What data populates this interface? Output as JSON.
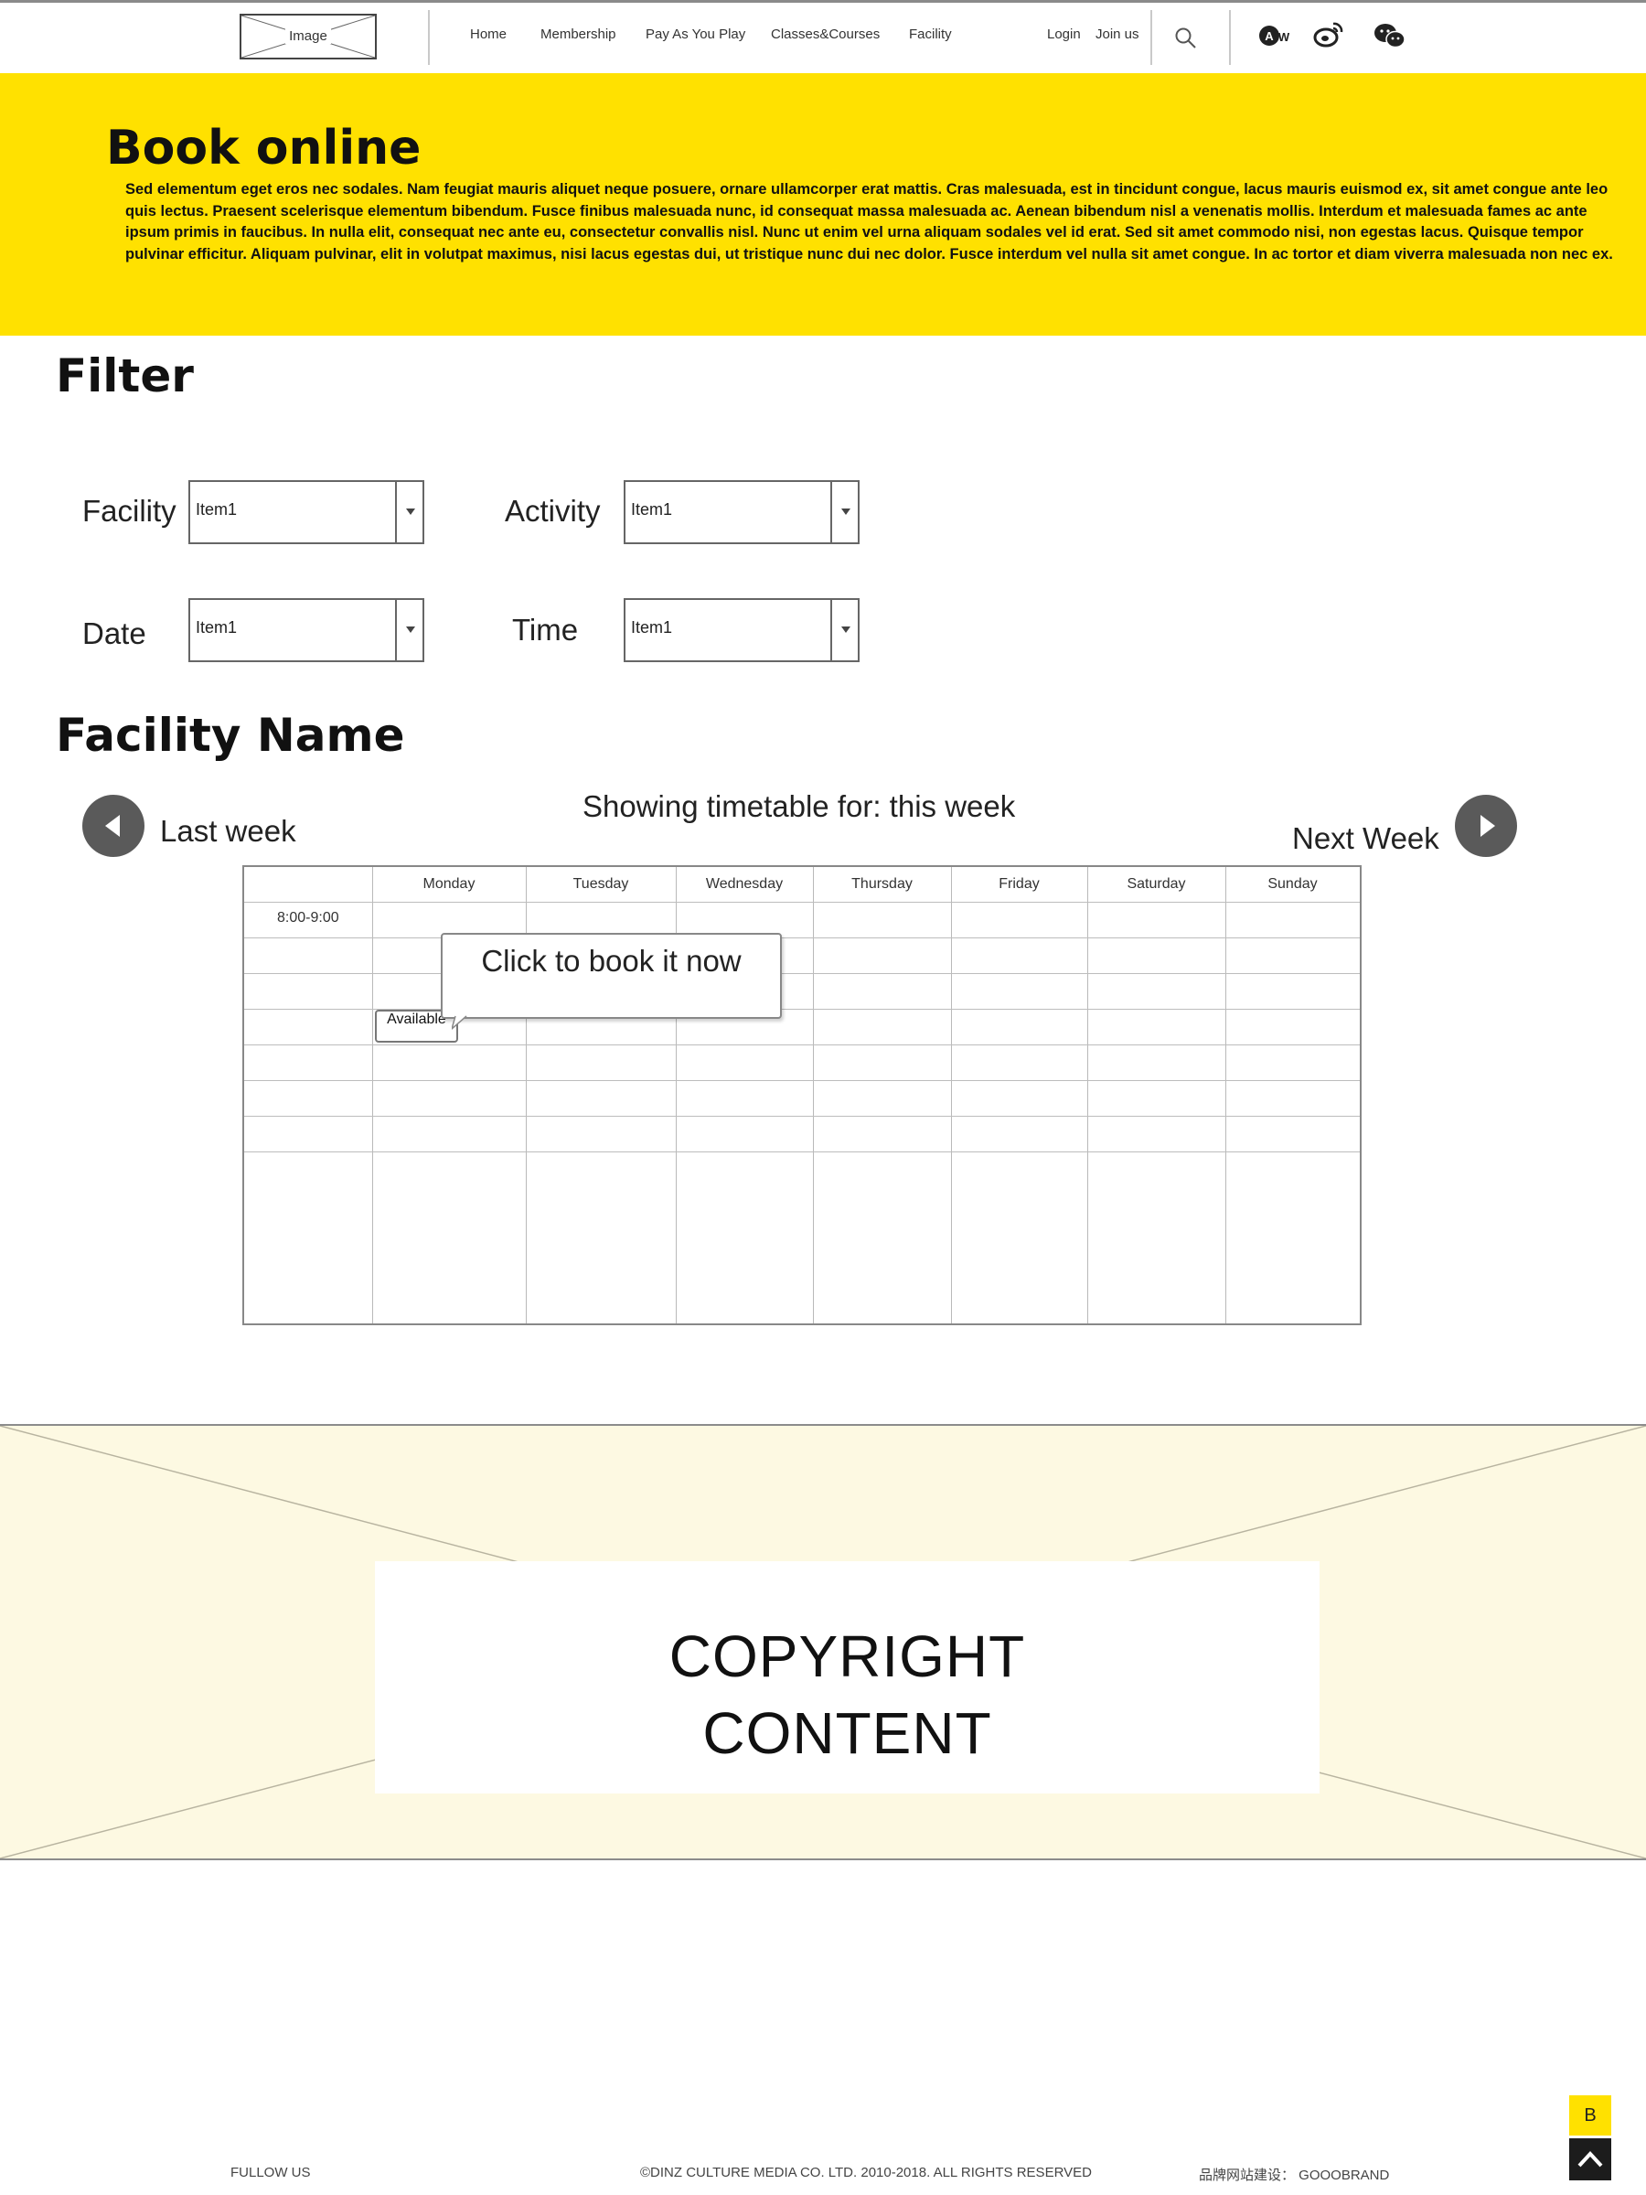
{
  "header": {
    "logo_label": "Image",
    "nav": [
      "Home",
      "Membership",
      "Pay As You Play",
      "Classes&Courses",
      "Facility"
    ],
    "login": "Login",
    "join": "Join us",
    "icons": [
      "search-icon",
      "aw-icon",
      "weibo-icon",
      "wechat-icon"
    ]
  },
  "banner": {
    "title": "Book online",
    "text": "Sed elementum eget eros nec sodales. Nam feugiat mauris aliquet neque posuere, ornare ullamcorper erat mattis. Cras malesuada, est in tincidunt congue, lacus mauris euismod ex, sit amet congue ante leo quis lectus. Praesent scelerisque elementum bibendum. Fusce finibus malesuada nunc, id consequat massa malesuada ac. Aenean bibendum nisl a venenatis mollis. Interdum et malesuada fames ac ante ipsum primis in faucibus. In nulla elit, consequat nec ante eu, consectetur convallis nisl. Nunc ut enim vel urna aliquam sodales vel id erat. Sed sit amet commodo nisi, non egestas lacus. Quisque tempor pulvinar efficitur. Aliquam pulvinar, elit in volutpat maximus, nisi lacus egestas dui, ut tristique nunc dui nec dolor. Fusce interdum vel nulla sit amet congue. In ac tortor et diam viverra malesuada non nec ex.",
    "color": "#ffe100"
  },
  "filter": {
    "title": "Filter",
    "facility": {
      "label": "Facility",
      "value": "Item1"
    },
    "activity": {
      "label": "Activity",
      "value": "Item1"
    },
    "date": {
      "label": "Date",
      "value": "Item1"
    },
    "time": {
      "label": "Time",
      "value": "Item1"
    }
  },
  "facility": {
    "title": "Facility Name",
    "last_week": "Last week",
    "next_week": "Next Week",
    "showing": "Showing timetable for: this week"
  },
  "timetable": {
    "days": [
      "Monday",
      "Tuesday",
      "Wednesday",
      "Thursday",
      "Friday",
      "Saturday",
      "Sunday"
    ],
    "first_time": "8:00-9:00",
    "slot_label": "Available",
    "tooltip": "Click to book it now"
  },
  "copyright": {
    "line1": "COPYRIGHT",
    "line2": "CONTENT"
  },
  "footer": {
    "follow": "FULLOW  US",
    "copyright": "©DINZ CULTURE MEDIA CO. LTD. 2010-2018. ALL RIGHTS RESERVED",
    "builder": "品牌网站建设：  GOOOBRAND",
    "badge": "B"
  }
}
